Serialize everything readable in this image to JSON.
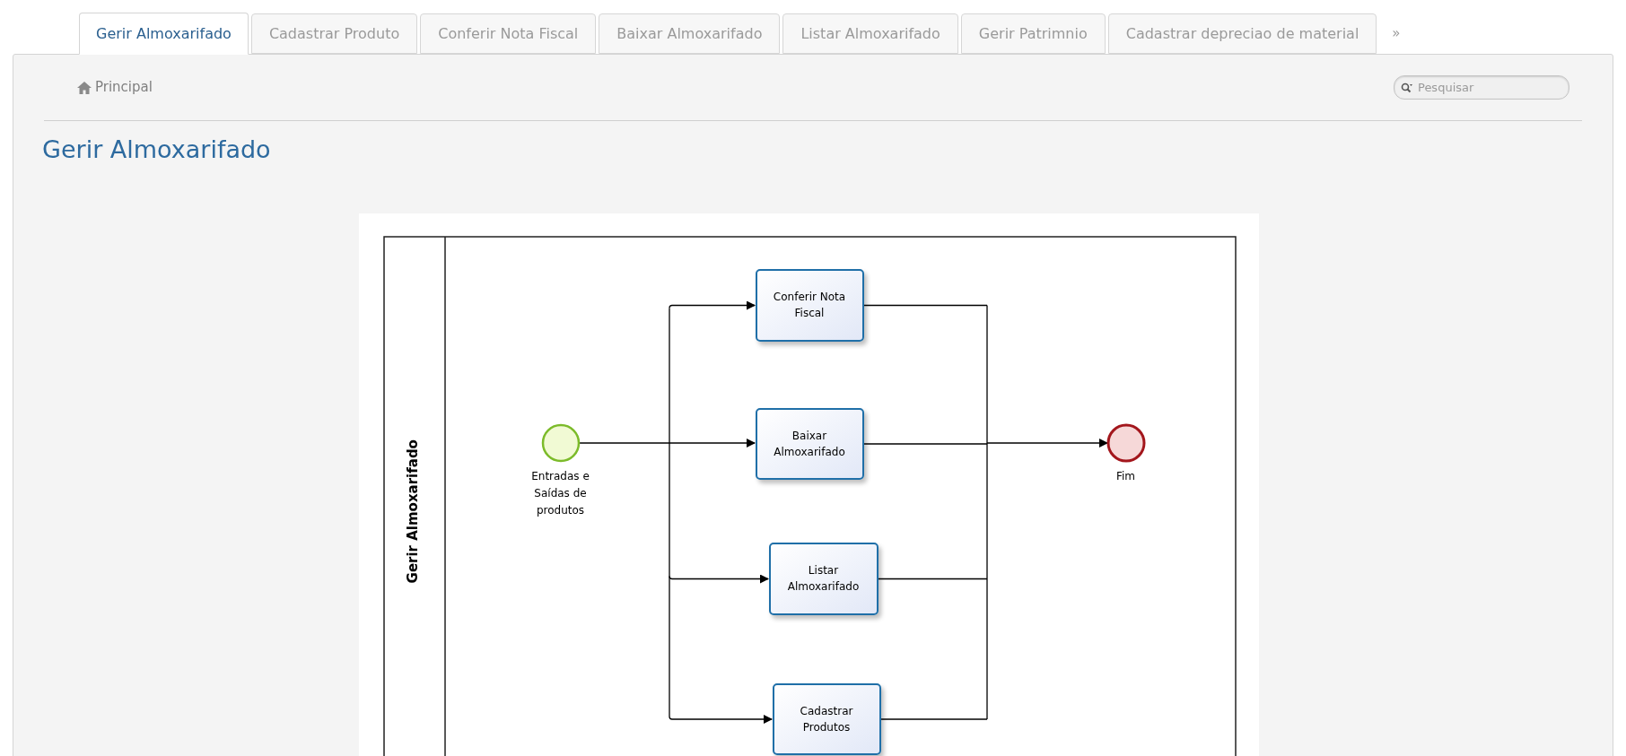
{
  "tabs": [
    {
      "label": "Gerir Almoxarifado",
      "selected": true
    },
    {
      "label": "Cadastrar Produto",
      "selected": false
    },
    {
      "label": "Conferir Nota Fiscal",
      "selected": false
    },
    {
      "label": "Baixar Almoxarifado",
      "selected": false
    },
    {
      "label": "Listar Almoxarifado",
      "selected": false
    },
    {
      "label": "Gerir Patrimnio",
      "selected": false
    },
    {
      "label": "Cadastrar depreciao de material",
      "selected": false
    }
  ],
  "more_tabs": "»",
  "breadcrumb": "Principal",
  "search": {
    "placeholder": "Pesquisar"
  },
  "heading": "Gerir Almoxarifado",
  "diagram": {
    "lane_label": "Gerir Almoxarifado",
    "start_event": {
      "label": "Entradas e Saídas de produtos"
    },
    "tasks": [
      {
        "label": "Conferir Nota Fiscal"
      },
      {
        "label": "Baixar Almoxarifado"
      },
      {
        "label": "Listar Almoxarifado"
      },
      {
        "label": "Cadastrar Produtos"
      }
    ],
    "end_event": {
      "label": "Fim"
    }
  }
}
